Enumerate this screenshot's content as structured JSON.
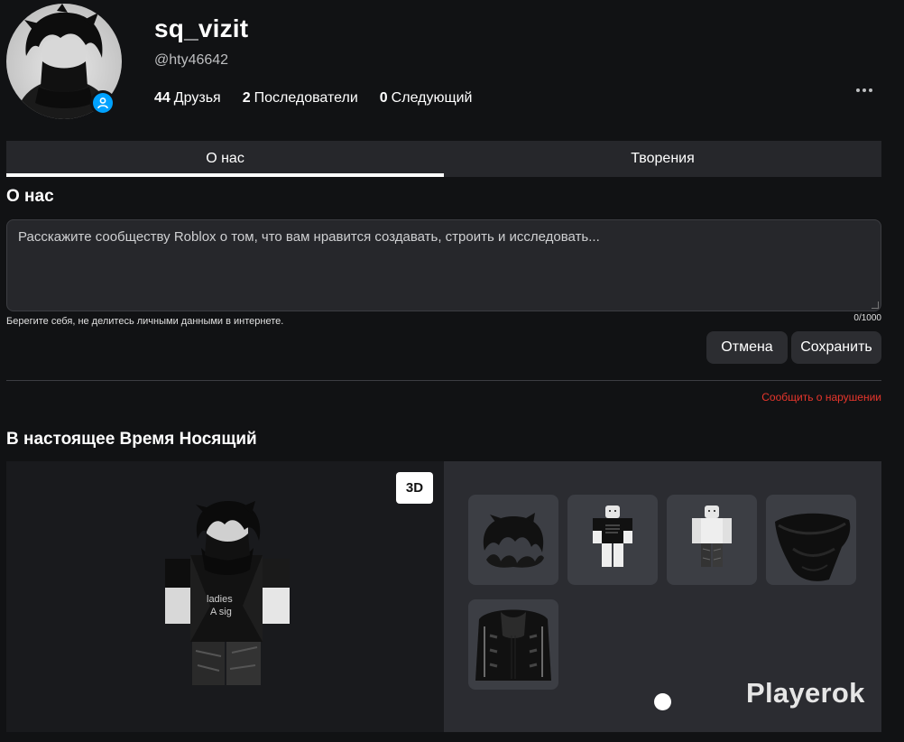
{
  "profile": {
    "display_name": "sq_vizit",
    "username": "@hty46642",
    "stats": [
      {
        "count": "44",
        "label": "Друзья"
      },
      {
        "count": "2",
        "label": "Последователи"
      },
      {
        "count": "0",
        "label": "Следующий"
      }
    ],
    "presence_icon": "user-online-icon",
    "more_icon": "more-horizontal-icon"
  },
  "tabs": [
    {
      "label": "О нас",
      "active": true
    },
    {
      "label": "Творения",
      "active": false
    }
  ],
  "about": {
    "title": "О нас",
    "placeholder": "Расскажите сообществу Roblox о том, что вам нравится создавать, строить и исследовать...",
    "safety_note": "Берегите себя, не делитесь личными данными в интернете.",
    "char_count": "0/1000",
    "cancel_label": "Отмена",
    "save_label": "Сохранить",
    "report_label": "Сообщить о нарушении"
  },
  "wearing": {
    "title": "В настоящее Время Носящий",
    "toggle_3d_label": "3D",
    "items": [
      {
        "name": "hair",
        "icon": "hair-icon"
      },
      {
        "name": "shirt-black",
        "icon": "shirt-icon"
      },
      {
        "name": "pants",
        "icon": "pants-icon"
      },
      {
        "name": "scarf",
        "icon": "scarf-icon"
      },
      {
        "name": "jacket",
        "icon": "jacket-icon"
      }
    ]
  },
  "watermark": "Playerok",
  "colors": {
    "background": "#111214",
    "surface": "#26272b",
    "accent": "#00a2ff",
    "danger": "#e8362c"
  }
}
